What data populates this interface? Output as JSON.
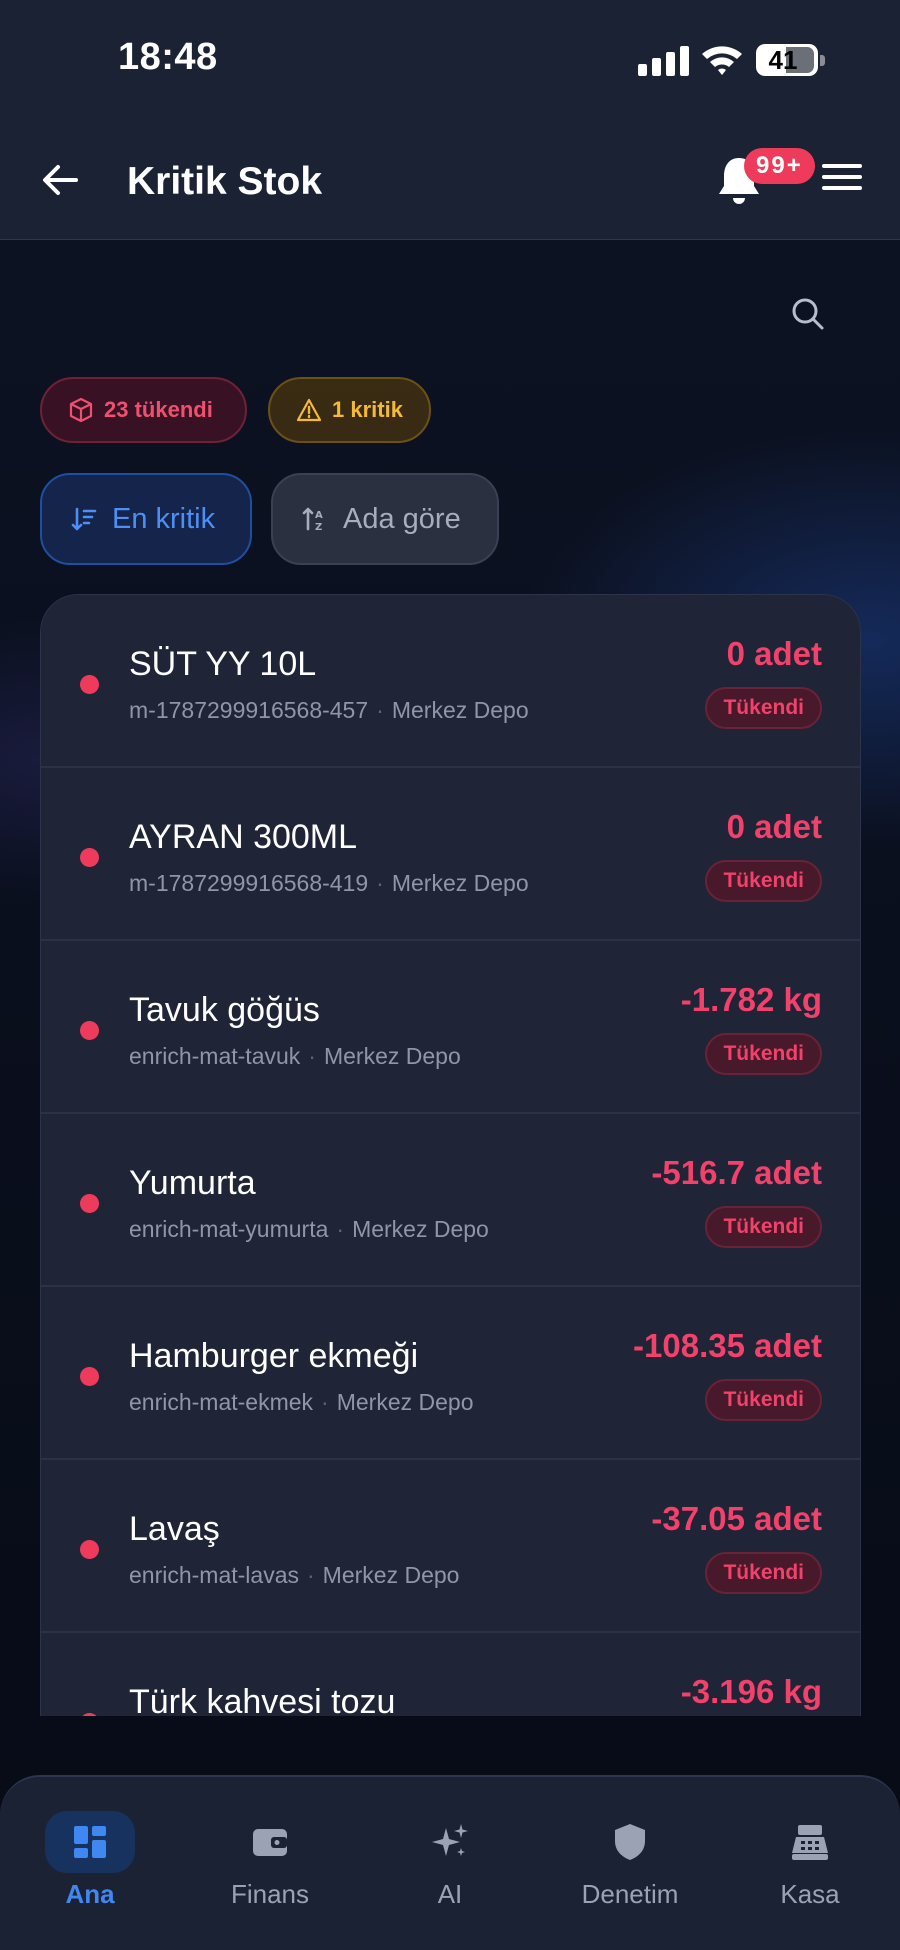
{
  "status_bar": {
    "time": "18:48",
    "battery": "41"
  },
  "header": {
    "title": "Kritik Stok",
    "notification_badge": "99+"
  },
  "chips": {
    "out_of_stock": "23 tükendi",
    "critical": "1 kritik"
  },
  "sort": {
    "most_critical": "En kritik",
    "by_name": "Ada göre"
  },
  "items": [
    {
      "name": "SÜT YY 10L",
      "code": "m-1787299916568-457",
      "location": "Merkez Depo",
      "quantity": "0 adet",
      "status": "Tükendi"
    },
    {
      "name": "AYRAN 300ML",
      "code": "m-1787299916568-419",
      "location": "Merkez Depo",
      "quantity": "0 adet",
      "status": "Tükendi"
    },
    {
      "name": "Tavuk göğüs",
      "code": "enrich-mat-tavuk",
      "location": "Merkez Depo",
      "quantity": "-1.782 kg",
      "status": "Tükendi"
    },
    {
      "name": "Yumurta",
      "code": "enrich-mat-yumurta",
      "location": "Merkez Depo",
      "quantity": "-516.7 adet",
      "status": "Tükendi"
    },
    {
      "name": "Hamburger ekmeği",
      "code": "enrich-mat-ekmek",
      "location": "Merkez Depo",
      "quantity": "-108.35 adet",
      "status": "Tükendi"
    },
    {
      "name": "Lavaş",
      "code": "enrich-mat-lavas",
      "location": "Merkez Depo",
      "quantity": "-37.05 adet",
      "status": "Tükendi"
    },
    {
      "name": "Türk kahvesi tozu",
      "code": "",
      "location": "",
      "quantity": "-3.196 kg",
      "status": ""
    }
  ],
  "nav": [
    {
      "label": "Ana",
      "icon": "dashboard-icon"
    },
    {
      "label": "Finans",
      "icon": "wallet-icon"
    },
    {
      "label": "AI",
      "icon": "sparkles-icon"
    },
    {
      "label": "Denetim",
      "icon": "shield-icon"
    },
    {
      "label": "Kasa",
      "icon": "cash-register-icon"
    }
  ],
  "colors": {
    "accent": "#3f88f2",
    "danger": "#f2416a",
    "warning": "#f4b93a",
    "surface": "#1f2437"
  }
}
